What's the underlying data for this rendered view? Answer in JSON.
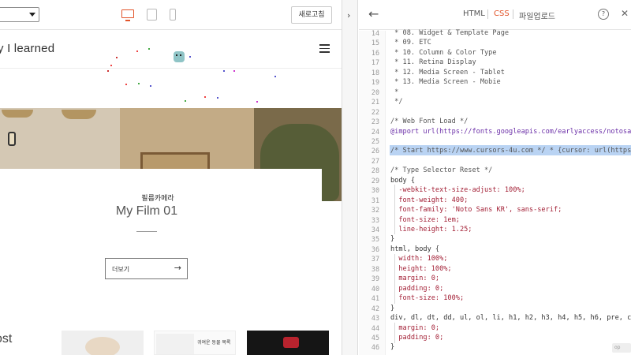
{
  "app": {
    "refresh_label": "새로고침",
    "device_icons": [
      "desktop-icon",
      "tablet-icon",
      "mobile-icon"
    ],
    "splitter_icon": "chevron-right-icon",
    "accent_color": "#e2542a"
  },
  "preview": {
    "site_title": "y I learned",
    "card_subtitle": "필름카메라",
    "card_title": "My Film 01",
    "more_button_label": "더보기",
    "section_label": "ost",
    "thumb2_text": "귀여운 동물 목록"
  },
  "editor": {
    "tabs": [
      {
        "label": "HTML",
        "active": false
      },
      {
        "label": "CSS",
        "active": true
      },
      {
        "label": "파일업로드",
        "active": false
      }
    ],
    "help_label": "?",
    "footer_text": "op",
    "line_numbers": [
      "14",
      "15",
      "16",
      "17",
      "18",
      "19",
      "20",
      "21",
      "22",
      "23",
      "24",
      "25",
      "26",
      "27",
      "28",
      "29",
      "30",
      "31",
      "32",
      "33",
      "34",
      "35",
      "36",
      "37",
      "38",
      "39",
      "40",
      "41",
      "42",
      "43",
      "44",
      "45",
      "46"
    ],
    "lines": [
      " * 08. Widget & Template Page",
      " * 09. ETC",
      " * 10. Column & Color Type",
      " * 11. Retina Display",
      " * 12. Media Screen - Tablet",
      " * 13. Media Screen - Mobie",
      " *",
      " */",
      "",
      "/* Web Font Load */",
      "@import url(https://fonts.googleapis.com/earlyaccess/notosans",
      "",
      "/* Start https://www.cursors-4u.com */ * {cursor: url(https:/",
      "",
      "/* Type Selector Reset */",
      "body {",
      "  -webkit-text-size-adjust: 100%;",
      "  font-weight: 400;",
      "  font-family: 'Noto Sans KR', sans-serif;",
      "  font-size: 1em;",
      "  line-height: 1.25;",
      "}",
      "html, body {",
      "  width: 100%;",
      "  height: 100%;",
      "  margin: 0;",
      "  padding: 0;",
      "  font-size: 100%;",
      "}",
      "div, dl, dt, dd, ul, ol, li, h1, h2, h3, h4, h5, h6, pre, coo",
      "  margin: 0;",
      "  padding: 0;",
      "}"
    ]
  }
}
